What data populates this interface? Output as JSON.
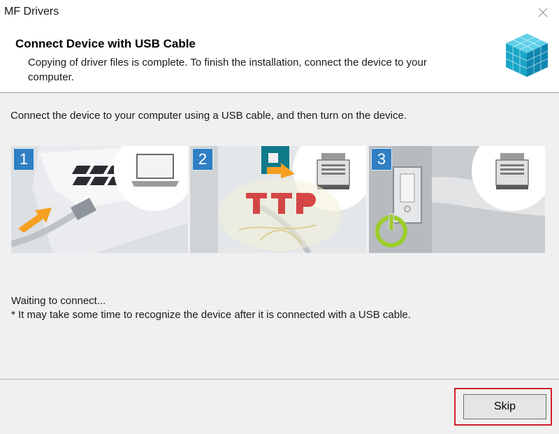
{
  "window": {
    "title": "MF Drivers"
  },
  "header": {
    "title": "Connect Device with USB Cable",
    "description": "Copying of driver files is complete. To finish the installation, connect the device to your computer.",
    "logo_icon": "cube-logo-icon"
  },
  "body": {
    "instruction": "Connect the device to your computer using a USB cable, and then turn on the device.",
    "steps": [
      {
        "number": "1",
        "icon": "laptop-usb-icon"
      },
      {
        "number": "2",
        "icon": "printer-usb-port-icon"
      },
      {
        "number": "3",
        "icon": "power-switch-icon"
      }
    ],
    "status_waiting": "Waiting to connect...",
    "status_note": "* It may take some time to recognize the device after it is connected with a USB cable."
  },
  "footer": {
    "skip_label": "Skip"
  },
  "colors": {
    "badge": "#2f7fc3",
    "arrow": "#f5a020",
    "power_green": "#9ccc2c",
    "highlight": "#d0202a"
  }
}
